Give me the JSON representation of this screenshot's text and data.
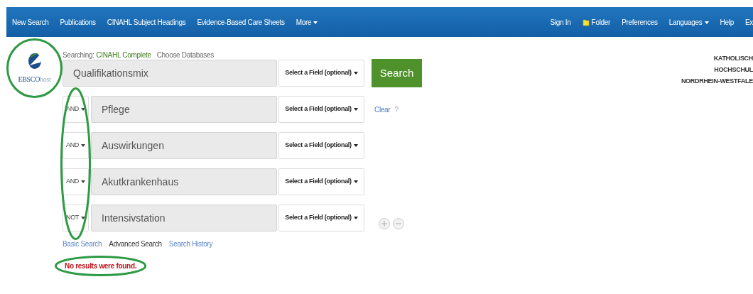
{
  "navbar": {
    "left": [
      "New Search",
      "Publications",
      "CINAHL Subject Headings",
      "Evidence-Based Care Sheets",
      "More"
    ],
    "right": [
      {
        "label": "Sign In",
        "kind": "link"
      },
      {
        "label": "Folder",
        "kind": "folder"
      },
      {
        "label": "Preferences",
        "kind": "link"
      },
      {
        "label": "Languages",
        "kind": "dropdown"
      },
      {
        "label": "Help",
        "kind": "link"
      },
      {
        "label": "Ex",
        "kind": "link"
      }
    ]
  },
  "logo": {
    "name": "EBSCO",
    "suffix": "host"
  },
  "searching": {
    "label": "Searching:",
    "database": "CINAHL Complete",
    "link": "Choose Databases"
  },
  "rows": [
    {
      "operator": null,
      "term": "Qualifikationsmix",
      "field": "Select a Field (optional)"
    },
    {
      "operator": "AND",
      "term": "Pflege",
      "field": "Select a Field (optional)"
    },
    {
      "operator": "AND",
      "term": "Auswirkungen",
      "field": "Select a Field (optional)"
    },
    {
      "operator": "AND",
      "term": "Akutkrankenhaus",
      "field": "Select a Field (optional)"
    },
    {
      "operator": "NOT",
      "term": "Intensivstation",
      "field": "Select a Field (optional)"
    }
  ],
  "search_button": "Search",
  "clear_link": "Clear",
  "help_mark": "?",
  "mode_links": [
    {
      "label": "Basic Search",
      "selected": false
    },
    {
      "label": "Advanced Search",
      "selected": true
    },
    {
      "label": "Search History",
      "selected": false
    }
  ],
  "message": "No results were found.",
  "institution": [
    "KATHOLISCH",
    "HOCHSCHUL",
    "NORDRHEIN-WESTFALE"
  ],
  "annotations": [
    {
      "kind": "logo"
    },
    {
      "kind": "operators"
    },
    {
      "kind": "message"
    }
  ]
}
